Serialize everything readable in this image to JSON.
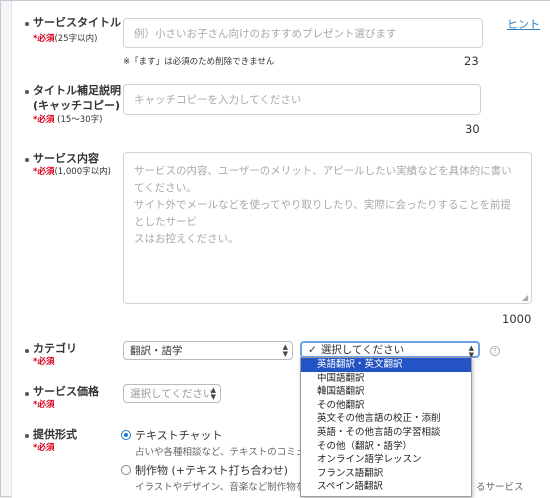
{
  "title_field": {
    "label": "サービスタイトル",
    "required": "*必須",
    "limit": "(25字以内)",
    "placeholder": "例）小さいお子さん向けのおすすめプレゼント選びます",
    "note": "※「ます」は必須のため削除できません",
    "counter": "23",
    "hint": "ヒント"
  },
  "catch_field": {
    "label_line1": "タイトル補足説明",
    "label_line2": "(キャッチコピー)",
    "required": "*必須",
    "limit": "(15〜30字)",
    "placeholder": "キャッチコピーを入力してください",
    "counter": "30"
  },
  "content_field": {
    "label": "サービス内容",
    "required": "*必須",
    "limit": "(1,000字以内)",
    "placeholder_lines": [
      "サービスの内容、ユーザーのメリット、アピールしたい実績などを具体的に書いてください。",
      "サイト外でメールなどを使ってやり取りしたり、実際に会ったりすることを前提としたサービ",
      "スはお控えください。"
    ],
    "counter": "1000"
  },
  "category_field": {
    "label": "カテゴリ",
    "required": "*必須",
    "main_value": "翻訳・語学",
    "sub_value": "選択してください",
    "help": "?",
    "dropdown": [
      "英語翻訳・英文翻訳",
      "中国語翻訳",
      "韓国語翻訳",
      "その他翻訳",
      "英文その他言語の校正・添削",
      "英語・その他言語の学習相談",
      "その他（翻訳・語学）",
      "オンライン語学レッスン",
      "フランス語翻訳",
      "スペイン語翻訳"
    ]
  },
  "price_field": {
    "label": "サービス価格",
    "required": "*必須",
    "placeholder": "選択してください"
  },
  "format_field": {
    "label": "提供形式",
    "required": "*必須",
    "options": [
      {
        "label": "テキストチャット",
        "desc": "占いや各種相談など、テキストのコミュニケ",
        "selected": true
      },
      {
        "label": "制作物 (+テキスト打ち合わせ)",
        "desc": "イラストやデザイン、音楽など制作物を最終",
        "selected": false
      }
    ],
    "overflow_tail": "るサービス"
  },
  "colors": {
    "accent": "#1f7ac8",
    "required": "#d9001b",
    "highlight": "#2453c6",
    "link": "#2a7fc1"
  }
}
